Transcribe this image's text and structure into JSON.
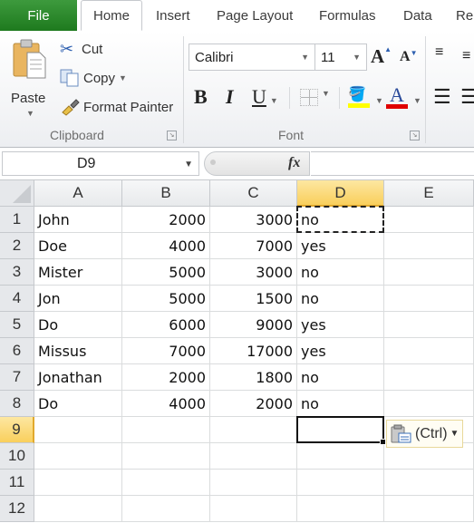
{
  "ribbon_tabs": {
    "file": "File",
    "home": "Home",
    "insert": "Insert",
    "page_layout": "Page Layout",
    "formulas": "Formulas",
    "data": "Data",
    "review_partial": "Re"
  },
  "clipboard": {
    "paste": "Paste",
    "cut": "Cut",
    "copy": "Copy",
    "format_painter": "Format Painter",
    "group_label": "Clipboard"
  },
  "font": {
    "font_name": "Calibri",
    "font_size": "11",
    "bold": "B",
    "italic": "I",
    "underline": "U",
    "grow": "A",
    "shrink": "A",
    "font_color_glyph": "A",
    "group_label": "Font",
    "fill_color": "#ffff00",
    "font_color": "#e00000"
  },
  "formula_bar": {
    "name_box": "D9",
    "fx_label": "fx",
    "formula": ""
  },
  "sheet": {
    "columns": [
      "A",
      "B",
      "C",
      "D",
      "E"
    ],
    "selected_column": "D",
    "selected_row": "9",
    "rows": [
      {
        "num": "1",
        "cells": [
          "John",
          "2000",
          "3000",
          "no",
          ""
        ]
      },
      {
        "num": "2",
        "cells": [
          "Doe",
          "4000",
          "7000",
          "yes",
          ""
        ]
      },
      {
        "num": "3",
        "cells": [
          "Mister",
          "5000",
          "3000",
          "no",
          ""
        ]
      },
      {
        "num": "4",
        "cells": [
          "Jon",
          "5000",
          "1500",
          "no",
          ""
        ]
      },
      {
        "num": "5",
        "cells": [
          "Do",
          "6000",
          "9000",
          "yes",
          ""
        ]
      },
      {
        "num": "6",
        "cells": [
          "Missus",
          "7000",
          "17000",
          "yes",
          ""
        ]
      },
      {
        "num": "7",
        "cells": [
          "Jonathan",
          "2000",
          "1800",
          "no",
          ""
        ]
      },
      {
        "num": "8",
        "cells": [
          "Do",
          "4000",
          "2000",
          "no",
          ""
        ]
      },
      {
        "num": "9",
        "cells": [
          "",
          "",
          "",
          "",
          ""
        ]
      },
      {
        "num": "10",
        "cells": [
          "",
          "",
          "",
          "",
          ""
        ]
      },
      {
        "num": "11",
        "cells": [
          "",
          "",
          "",
          "",
          ""
        ]
      },
      {
        "num": "12",
        "cells": [
          "",
          "",
          "",
          "",
          ""
        ]
      }
    ]
  },
  "paste_options": {
    "label": "(Ctrl)"
  }
}
